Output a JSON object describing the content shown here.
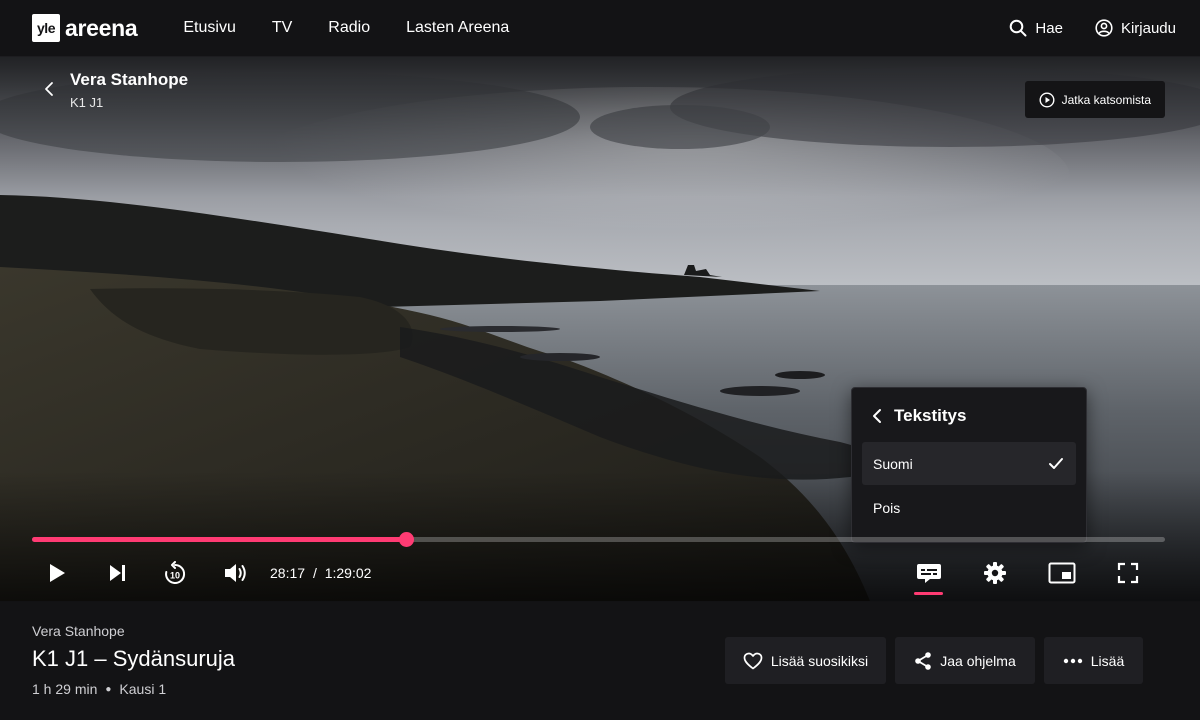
{
  "header": {
    "logo_box": "yle",
    "logo_word": "areena",
    "nav": [
      "Etusivu",
      "TV",
      "Radio",
      "Lasten Areena"
    ],
    "search_label": "Hae",
    "login_label": "Kirjaudu"
  },
  "player": {
    "title": "Vera Stanhope",
    "subtitle": "K1 J1",
    "continue_label": "Jatka katsomista",
    "progress": 0.33,
    "current_time": "28:17",
    "time_separator": "/",
    "duration": "1:29:02"
  },
  "subtitle_menu": {
    "title": "Tekstitys",
    "options": [
      {
        "label": "Suomi",
        "selected": true
      },
      {
        "label": "Pois",
        "selected": false
      }
    ]
  },
  "info": {
    "series": "Vera Stanhope",
    "episode_title": "K1 J1 – Sydänsuruja",
    "duration": "1 h 29 min",
    "season": "Kausi 1",
    "actions": {
      "favorite": "Lisää suosikiksi",
      "share": "Jaa ohjelma",
      "more": "Lisää"
    }
  },
  "colors": {
    "accent": "#ff3b73",
    "background": "#131315"
  }
}
